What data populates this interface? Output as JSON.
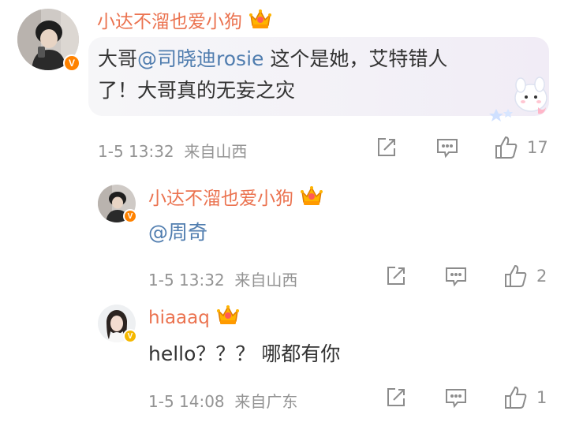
{
  "comment": {
    "username": "小达不溜也爱小狗",
    "text_prefix": "大哥",
    "mention": "@司晓迪rosie",
    "text_suffix": " 这个是她，艾特错人",
    "text_line2": "了！大哥真的无妄之灾",
    "time": "1-5 13:32",
    "location": "来自山西",
    "likes": "17"
  },
  "replies": [
    {
      "username": "小达不溜也爱小狗",
      "mention": "@周奇",
      "time": "1-5 13:32",
      "location": "来自山西",
      "likes": "2"
    },
    {
      "username": "hiaaaq",
      "text": "hello？？？ 哪都有你",
      "time": "1-5 14:08",
      "location": "来自广东",
      "likes": "1"
    }
  ],
  "icons": [
    "crown-badge-icon",
    "verified-v-icon",
    "share-icon",
    "comment-icon",
    "like-icon",
    "bunny-sticker-icon"
  ],
  "colors": {
    "username": "#eb7350",
    "mention": "#507daf",
    "meta": "#939393",
    "verified": "#ff8200"
  }
}
